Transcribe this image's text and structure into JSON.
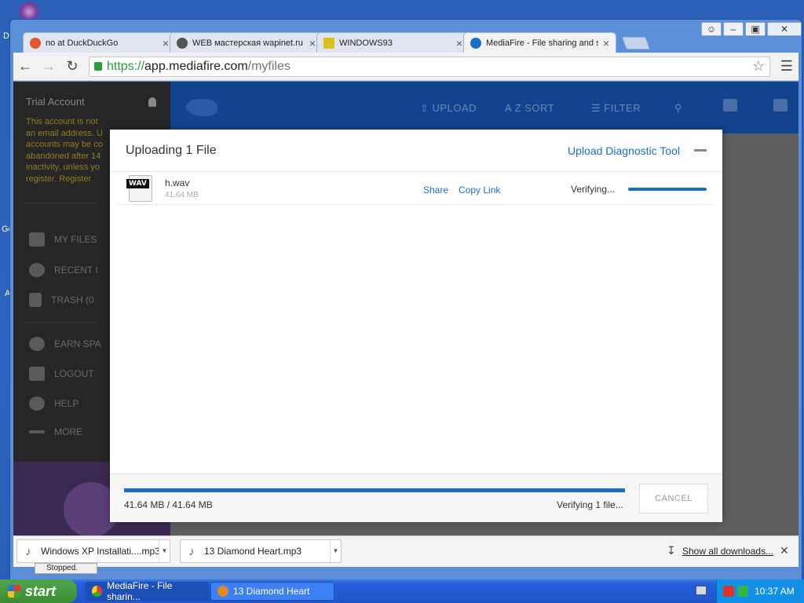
{
  "desktop": {
    "labels": [
      "D:",
      "Go",
      "A"
    ]
  },
  "browser": {
    "tabs": [
      {
        "title": "no at DuckDuckGo",
        "fav_color": "#de5833"
      },
      {
        "title": "WEB мастерская wapinet.ru",
        "fav_color": "#555555"
      },
      {
        "title": "WINDOWS93",
        "fav_color": "#d8c020"
      },
      {
        "title": "MediaFire - File sharing and s",
        "fav_color": "#1a6fc4",
        "active": true
      }
    ],
    "url": {
      "scheme": "https://",
      "host": "app.mediafire.com",
      "path": "/myfiles"
    }
  },
  "sidebar": {
    "account": "Trial Account",
    "warning_lines": [
      "This account is not",
      "an email address. U",
      "accounts may be co",
      "abandoned after 14",
      "inactivity, unless yo",
      "register."
    ],
    "register_link": "Register",
    "items": [
      {
        "label": "MY FILES"
      },
      {
        "label": "RECENT I"
      },
      {
        "label": "TRASH (0"
      },
      {
        "label": "EARN SPA"
      },
      {
        "label": "LOGOUT"
      },
      {
        "label": "HELP"
      },
      {
        "label": "MORE"
      }
    ]
  },
  "topbar": {
    "upload": "UPLOAD",
    "sort": "SORT",
    "filter": "FILTER",
    "sort_icon_text": "A Z"
  },
  "upload_dialog": {
    "title": "Uploading 1 File",
    "diagnostic_link": "Upload Diagnostic Tool",
    "file": {
      "type_tag": "WAV",
      "name": "h.wav",
      "size": "41.64 MB",
      "share": "Share",
      "copy_link": "Copy Link",
      "status": "Verifying..."
    },
    "progress": {
      "fraction": 1.0,
      "text": "41.64 MB / 41.64 MB",
      "status": "Verifying 1 file..."
    },
    "cancel": "CANCEL"
  },
  "downloads": {
    "items": [
      {
        "name": "Windows XP Installati....mp3"
      },
      {
        "name": "13 Diamond Heart.mp3"
      }
    ],
    "show_all": "Show all downloads...",
    "stopped": "Stopped."
  },
  "taskbar": {
    "start": "start",
    "tasks": [
      {
        "label": "MediaFire - File sharin..."
      },
      {
        "label": "13 Diamond Heart"
      }
    ],
    "clock": "10:37 AM"
  }
}
